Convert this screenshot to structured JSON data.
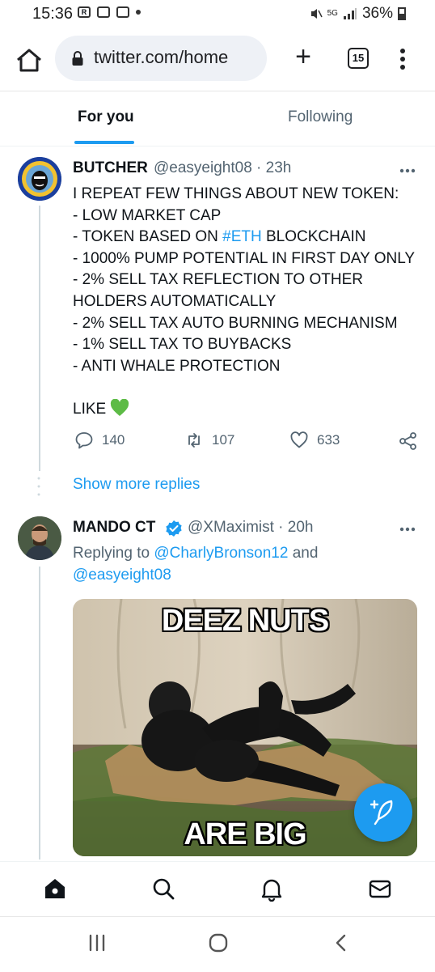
{
  "status_bar": {
    "time": "15:36",
    "battery": "36%",
    "network": "5G",
    "tabs_icon_text": "15"
  },
  "browser": {
    "url": "twitter.com/home"
  },
  "tabs": {
    "for_you": "For you",
    "following": "Following"
  },
  "tweet1": {
    "name": "BUTCHER",
    "handle": "@easyeight08 · 23h",
    "lines": {
      "l1": "I REPEAT FEW THINGS ABOUT NEW TOKEN:",
      "l2": "- LOW MARKET CAP",
      "l3_prefix": "- TOKEN BASED ON ",
      "l3_link": "#ETH",
      "l3_suffix": " BLOCKCHAIN",
      "l4": "- 1000% PUMP POTENTIAL IN FIRST DAY ONLY",
      "l5": "- 2% SELL TAX REFLECTION TO OTHER",
      "l6": "HOLDERS AUTOMATICALLY",
      "l7": "- 2% SELL TAX AUTO BURNING MECHANISM",
      "l8": "- 1% SELL TAX TO BUYBACKS",
      "l9": "- ANTI WHALE PROTECTION",
      "l10": "LIKE"
    },
    "replies": "140",
    "retweets": "107",
    "likes": "633"
  },
  "show_more_replies": "Show more replies",
  "tweet2": {
    "name": "MANDO CT",
    "handle": "@XMaximist · 20h",
    "replying_prefix": "Replying to ",
    "replying_to_1": "@CharlyBronson12",
    "replying_and": " and",
    "replying_to_2": "@easyeight08",
    "meme_top": "DEEZ NUTS",
    "meme_bottom": "ARE BIG"
  },
  "colors": {
    "accent": "#1d9bf0",
    "secondary_text": "#536471",
    "heart": "#5dbb46"
  }
}
